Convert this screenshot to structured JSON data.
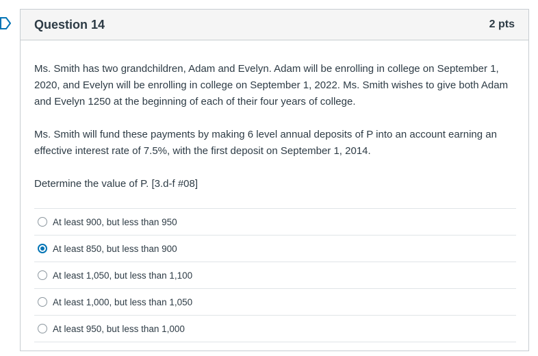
{
  "question": {
    "title": "Question 14",
    "points": "2 pts",
    "paragraphs": [
      "Ms. Smith has two grandchildren, Adam and Evelyn. Adam will be enrolling in college on September 1, 2020, and Evelyn will be enrolling in college on September 1, 2022. Ms. Smith wishes to give both Adam and Evelyn 1250 at the beginning of each of their four years of college.",
      "Ms. Smith will fund these payments by making 6 level annual deposits of P into an account earning an effective interest rate of 7.5%, with the first deposit on September 1, 2014.",
      "Determine the value of P. [3.d-f #08]"
    ]
  },
  "answers": [
    {
      "label": "At least 900, but less than 950",
      "selected": false
    },
    {
      "label": "At least 850, but less than 900",
      "selected": true
    },
    {
      "label": "At least 1,050, but less than 1,100",
      "selected": false
    },
    {
      "label": "At least 1,000, but less than 1,050",
      "selected": false
    },
    {
      "label": "At least 950, but less than 1,000",
      "selected": false
    }
  ],
  "colors": {
    "accent": "#0374b5",
    "header_bg": "#f5f5f5",
    "border": "#c7cdd1",
    "text": "#2d3b45"
  }
}
